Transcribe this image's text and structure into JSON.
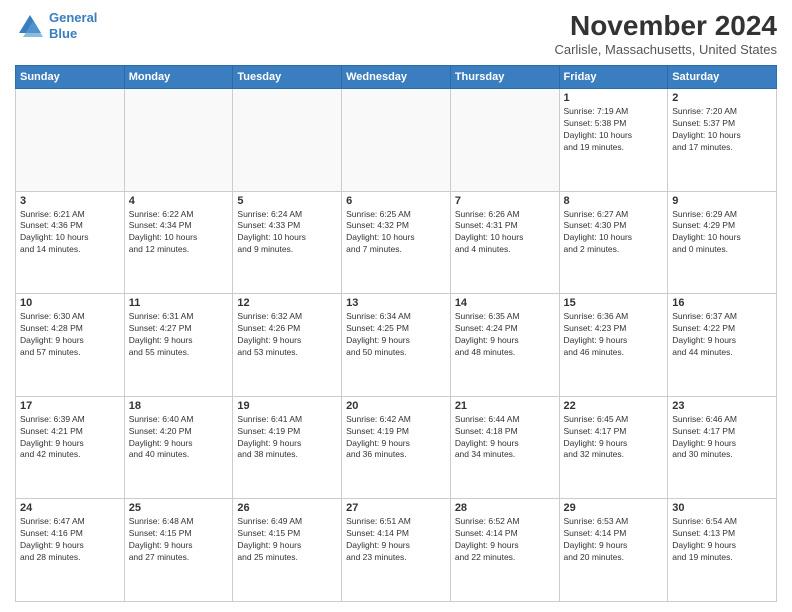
{
  "header": {
    "logo_line1": "General",
    "logo_line2": "Blue",
    "title": "November 2024",
    "location": "Carlisle, Massachusetts, United States"
  },
  "days_of_week": [
    "Sunday",
    "Monday",
    "Tuesday",
    "Wednesday",
    "Thursday",
    "Friday",
    "Saturday"
  ],
  "weeks": [
    [
      {
        "day": "",
        "info": ""
      },
      {
        "day": "",
        "info": ""
      },
      {
        "day": "",
        "info": ""
      },
      {
        "day": "",
        "info": ""
      },
      {
        "day": "",
        "info": ""
      },
      {
        "day": "1",
        "info": "Sunrise: 7:19 AM\nSunset: 5:38 PM\nDaylight: 10 hours\nand 19 minutes."
      },
      {
        "day": "2",
        "info": "Sunrise: 7:20 AM\nSunset: 5:37 PM\nDaylight: 10 hours\nand 17 minutes."
      }
    ],
    [
      {
        "day": "3",
        "info": "Sunrise: 6:21 AM\nSunset: 4:36 PM\nDaylight: 10 hours\nand 14 minutes."
      },
      {
        "day": "4",
        "info": "Sunrise: 6:22 AM\nSunset: 4:34 PM\nDaylight: 10 hours\nand 12 minutes."
      },
      {
        "day": "5",
        "info": "Sunrise: 6:24 AM\nSunset: 4:33 PM\nDaylight: 10 hours\nand 9 minutes."
      },
      {
        "day": "6",
        "info": "Sunrise: 6:25 AM\nSunset: 4:32 PM\nDaylight: 10 hours\nand 7 minutes."
      },
      {
        "day": "7",
        "info": "Sunrise: 6:26 AM\nSunset: 4:31 PM\nDaylight: 10 hours\nand 4 minutes."
      },
      {
        "day": "8",
        "info": "Sunrise: 6:27 AM\nSunset: 4:30 PM\nDaylight: 10 hours\nand 2 minutes."
      },
      {
        "day": "9",
        "info": "Sunrise: 6:29 AM\nSunset: 4:29 PM\nDaylight: 10 hours\nand 0 minutes."
      }
    ],
    [
      {
        "day": "10",
        "info": "Sunrise: 6:30 AM\nSunset: 4:28 PM\nDaylight: 9 hours\nand 57 minutes."
      },
      {
        "day": "11",
        "info": "Sunrise: 6:31 AM\nSunset: 4:27 PM\nDaylight: 9 hours\nand 55 minutes."
      },
      {
        "day": "12",
        "info": "Sunrise: 6:32 AM\nSunset: 4:26 PM\nDaylight: 9 hours\nand 53 minutes."
      },
      {
        "day": "13",
        "info": "Sunrise: 6:34 AM\nSunset: 4:25 PM\nDaylight: 9 hours\nand 50 minutes."
      },
      {
        "day": "14",
        "info": "Sunrise: 6:35 AM\nSunset: 4:24 PM\nDaylight: 9 hours\nand 48 minutes."
      },
      {
        "day": "15",
        "info": "Sunrise: 6:36 AM\nSunset: 4:23 PM\nDaylight: 9 hours\nand 46 minutes."
      },
      {
        "day": "16",
        "info": "Sunrise: 6:37 AM\nSunset: 4:22 PM\nDaylight: 9 hours\nand 44 minutes."
      }
    ],
    [
      {
        "day": "17",
        "info": "Sunrise: 6:39 AM\nSunset: 4:21 PM\nDaylight: 9 hours\nand 42 minutes."
      },
      {
        "day": "18",
        "info": "Sunrise: 6:40 AM\nSunset: 4:20 PM\nDaylight: 9 hours\nand 40 minutes."
      },
      {
        "day": "19",
        "info": "Sunrise: 6:41 AM\nSunset: 4:19 PM\nDaylight: 9 hours\nand 38 minutes."
      },
      {
        "day": "20",
        "info": "Sunrise: 6:42 AM\nSunset: 4:19 PM\nDaylight: 9 hours\nand 36 minutes."
      },
      {
        "day": "21",
        "info": "Sunrise: 6:44 AM\nSunset: 4:18 PM\nDaylight: 9 hours\nand 34 minutes."
      },
      {
        "day": "22",
        "info": "Sunrise: 6:45 AM\nSunset: 4:17 PM\nDaylight: 9 hours\nand 32 minutes."
      },
      {
        "day": "23",
        "info": "Sunrise: 6:46 AM\nSunset: 4:17 PM\nDaylight: 9 hours\nand 30 minutes."
      }
    ],
    [
      {
        "day": "24",
        "info": "Sunrise: 6:47 AM\nSunset: 4:16 PM\nDaylight: 9 hours\nand 28 minutes."
      },
      {
        "day": "25",
        "info": "Sunrise: 6:48 AM\nSunset: 4:15 PM\nDaylight: 9 hours\nand 27 minutes."
      },
      {
        "day": "26",
        "info": "Sunrise: 6:49 AM\nSunset: 4:15 PM\nDaylight: 9 hours\nand 25 minutes."
      },
      {
        "day": "27",
        "info": "Sunrise: 6:51 AM\nSunset: 4:14 PM\nDaylight: 9 hours\nand 23 minutes."
      },
      {
        "day": "28",
        "info": "Sunrise: 6:52 AM\nSunset: 4:14 PM\nDaylight: 9 hours\nand 22 minutes."
      },
      {
        "day": "29",
        "info": "Sunrise: 6:53 AM\nSunset: 4:14 PM\nDaylight: 9 hours\nand 20 minutes."
      },
      {
        "day": "30",
        "info": "Sunrise: 6:54 AM\nSunset: 4:13 PM\nDaylight: 9 hours\nand 19 minutes."
      }
    ]
  ]
}
